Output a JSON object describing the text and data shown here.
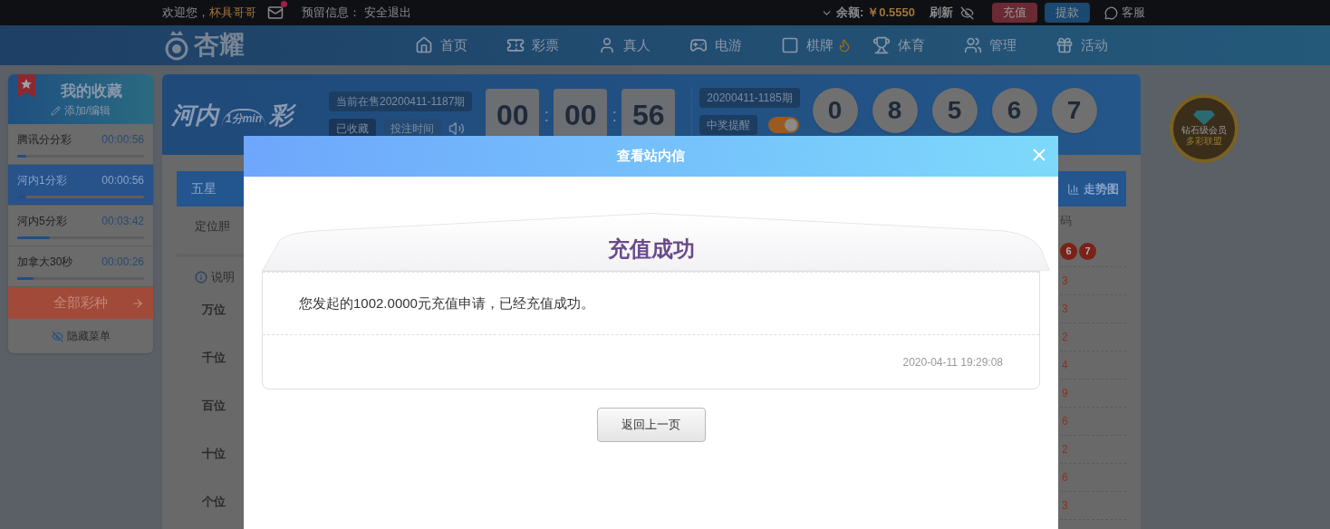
{
  "top_bar": {
    "welcome": "欢迎您，",
    "username": "杯具哥哥",
    "mail_unread": true,
    "reserved_info": "预留信息：",
    "logout": "安全退出",
    "balance_label": "余额:",
    "balance": "￥0.5550",
    "refresh": "刷新",
    "deposit": "充值",
    "withdraw": "提款",
    "support": "客服"
  },
  "nav": {
    "logo": "杏耀",
    "items": [
      {
        "label": "首页",
        "hot": false
      },
      {
        "label": "彩票",
        "hot": false
      },
      {
        "label": "真人",
        "hot": false
      },
      {
        "label": "电游",
        "hot": false
      },
      {
        "label": "棋牌",
        "hot": true
      },
      {
        "label": "体育",
        "hot": false
      },
      {
        "label": "管理",
        "hot": false
      },
      {
        "label": "活动",
        "hot": false
      }
    ]
  },
  "favorites": {
    "title": "我的收藏",
    "edit": "添加/编辑",
    "items": [
      {
        "name": "腾讯分分彩",
        "time": "00:00:56",
        "level": 0.07,
        "selected": false
      },
      {
        "name": "河内1分彩",
        "time": "00:00:56",
        "level": 0.07,
        "selected": true
      },
      {
        "name": "河内5分彩",
        "time": "00:03:42",
        "level": 0.26,
        "selected": false
      },
      {
        "name": "加拿大30秒",
        "time": "00:00:26",
        "level": 0.13,
        "selected": false
      }
    ],
    "all_button": "全部彩种",
    "hide_menu": "隐藏菜单"
  },
  "game": {
    "logo": "河内",
    "logo_sub": "1分min",
    "logo_end": "彩",
    "current_issue": "当前在售20200411-1187期",
    "favorited": "已收藏",
    "bet_time": "投注时间",
    "countdown": [
      "00",
      "00",
      "56"
    ],
    "separator": ":",
    "last_issue": "20200411-1185期",
    "win_alert": "中奖提醒",
    "win_alert_on": true,
    "result": [
      "0",
      "8",
      "5",
      "6",
      "7"
    ]
  },
  "badge": {
    "title": "钻石级会员",
    "sub": "多彩联盟"
  },
  "play": {
    "tabs": [
      {
        "label": "五星",
        "selected": true
      }
    ],
    "trend": "走势图",
    "sub_tab": "定位胆",
    "info": "说明",
    "positions": [
      "万位",
      "千位",
      "百位",
      "十位",
      "个位"
    ]
  },
  "history": {
    "column": "码",
    "top_balls": [
      "6",
      "7"
    ],
    "rows": [
      "3",
      "3",
      "2",
      "4",
      "9",
      "6",
      "2",
      "6",
      "3"
    ]
  },
  "modal": {
    "title": "查看站内信",
    "heading": "充值成功",
    "message": "您发起的1002.0000元充值申请，已经充值成功。",
    "time": "2020-04-11 19:29:08",
    "back_button": "返回上一页"
  }
}
